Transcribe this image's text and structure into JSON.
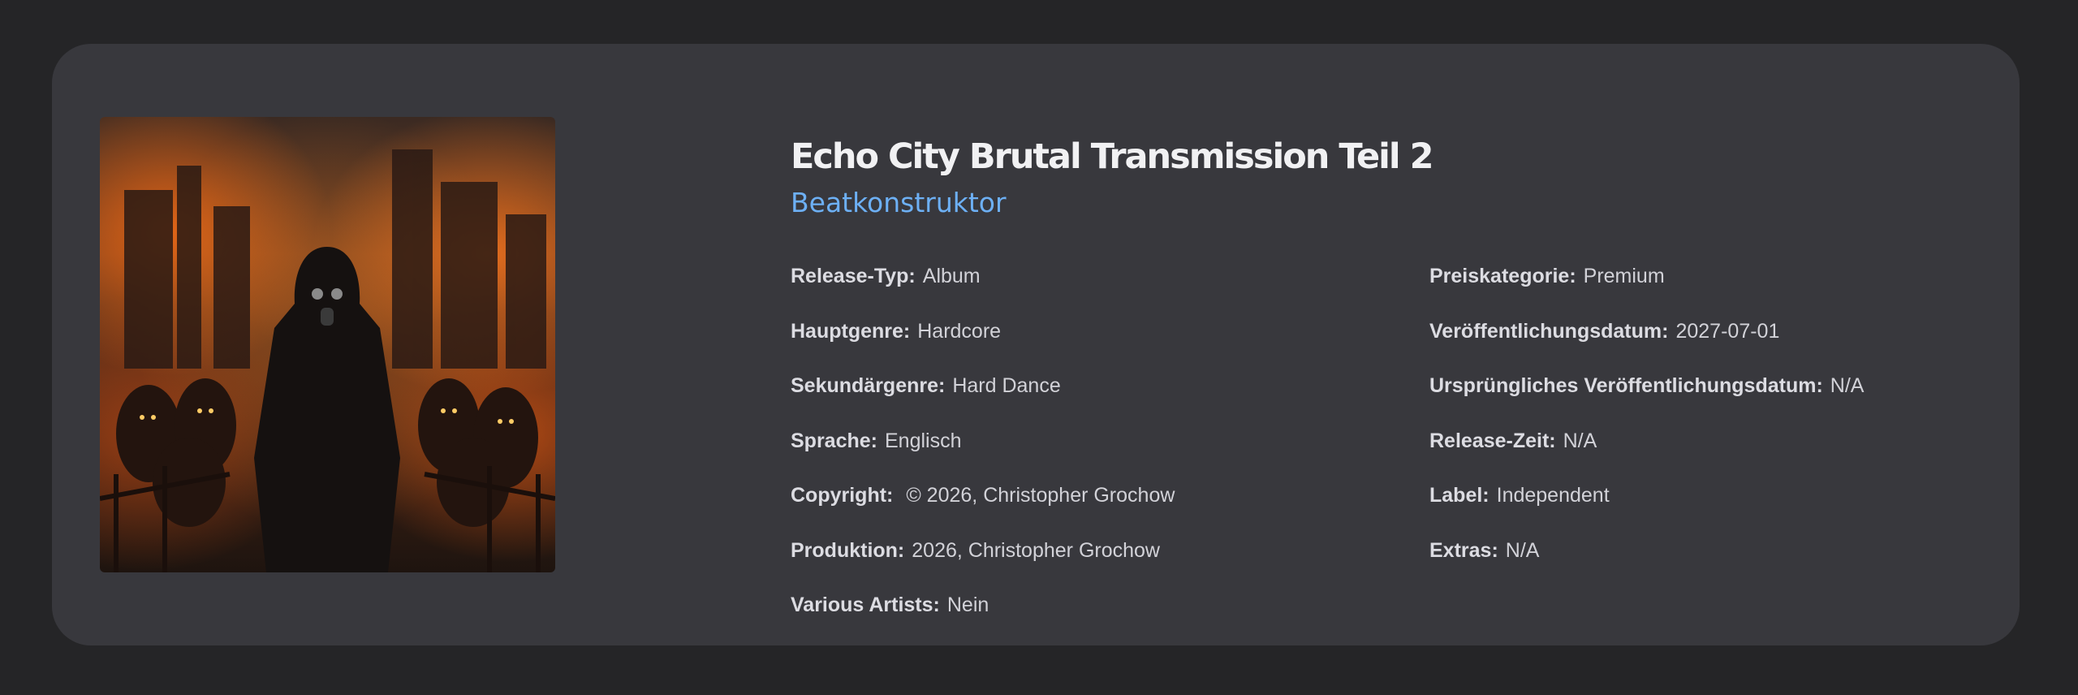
{
  "release": {
    "title": "Echo City Brutal Transmission Teil 2",
    "artist": "Beatkonstruktor"
  },
  "details_left": [
    {
      "key": "Release-Typ:",
      "value": "Album"
    },
    {
      "key": "Hauptgenre:",
      "value": "Hardcore"
    },
    {
      "key": "Sekundärgenre:",
      "value": "Hard Dance"
    },
    {
      "key": "Sprache:",
      "value": "Englisch"
    },
    {
      "key": "Copyright:",
      "value": " © 2026, Christopher Grochow"
    },
    {
      "key": "Produktion:",
      "value": "2026, Christopher Grochow"
    },
    {
      "key": "Various Artists:",
      "value": "Nein"
    }
  ],
  "details_right": [
    {
      "key": "Preiskategorie:",
      "value": "Premium"
    },
    {
      "key": "Veröffentlichungsdatum:",
      "value": "2027-07-01"
    },
    {
      "key": "Ursprüngliches Veröffentlichungsdatum:",
      "value": "N/A"
    },
    {
      "key": "Release-Zeit:",
      "value": "N/A"
    },
    {
      "key": "Label:",
      "value": "Independent"
    },
    {
      "key": "Extras:",
      "value": "N/A"
    }
  ],
  "colors": {
    "background": "#252527",
    "card": "#38383d",
    "accent": "#6db0f5"
  }
}
